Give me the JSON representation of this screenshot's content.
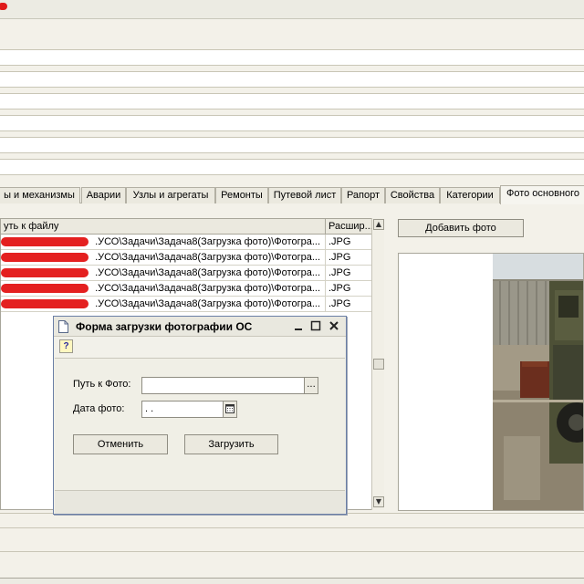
{
  "tabs": [
    {
      "label": "ы и механизмы"
    },
    {
      "label": "Аварии"
    },
    {
      "label": "Узлы и агрегаты"
    },
    {
      "label": "Ремонты"
    },
    {
      "label": "Путевой лист"
    },
    {
      "label": "Рапорт"
    },
    {
      "label": "Свойства"
    },
    {
      "label": "Категории"
    },
    {
      "label": "Фото основного"
    }
  ],
  "grid": {
    "columns": [
      "уть к файлу",
      "Расшир..."
    ],
    "rows": [
      {
        "path": ".УСО\\Задачи\\Задача8(Загрузка фото)\\Фотогра...",
        "ext": ".JPG"
      },
      {
        "path": ".УСО\\Задачи\\Задача8(Загрузка фото)\\Фотогра...",
        "ext": ".JPG"
      },
      {
        "path": ".УСО\\Задачи\\Задача8(Загрузка фото)\\Фотогра...",
        "ext": ".JPG"
      },
      {
        "path": ".УСО\\Задачи\\Задача8(Загрузка фото)\\Фотогра...",
        "ext": ".JPG"
      },
      {
        "path": ".УСО\\Задачи\\Задача8(Загрузка фото)\\Фотогра...",
        "ext": ".JPG"
      }
    ]
  },
  "add_photo_label": "Добавить фото",
  "dialog": {
    "title": "Форма загрузки фотографии ОС",
    "help_label": "?",
    "path_label": "Путь к Фото:",
    "path_value": "",
    "path_button": "...",
    "date_label": "Дата фото:",
    "date_value": " .  .",
    "cancel_label": "Отменить",
    "upload_label": "Загрузить"
  },
  "colors": {
    "redaction": "#e42020",
    "dialog_border": "#6b7fa6"
  }
}
